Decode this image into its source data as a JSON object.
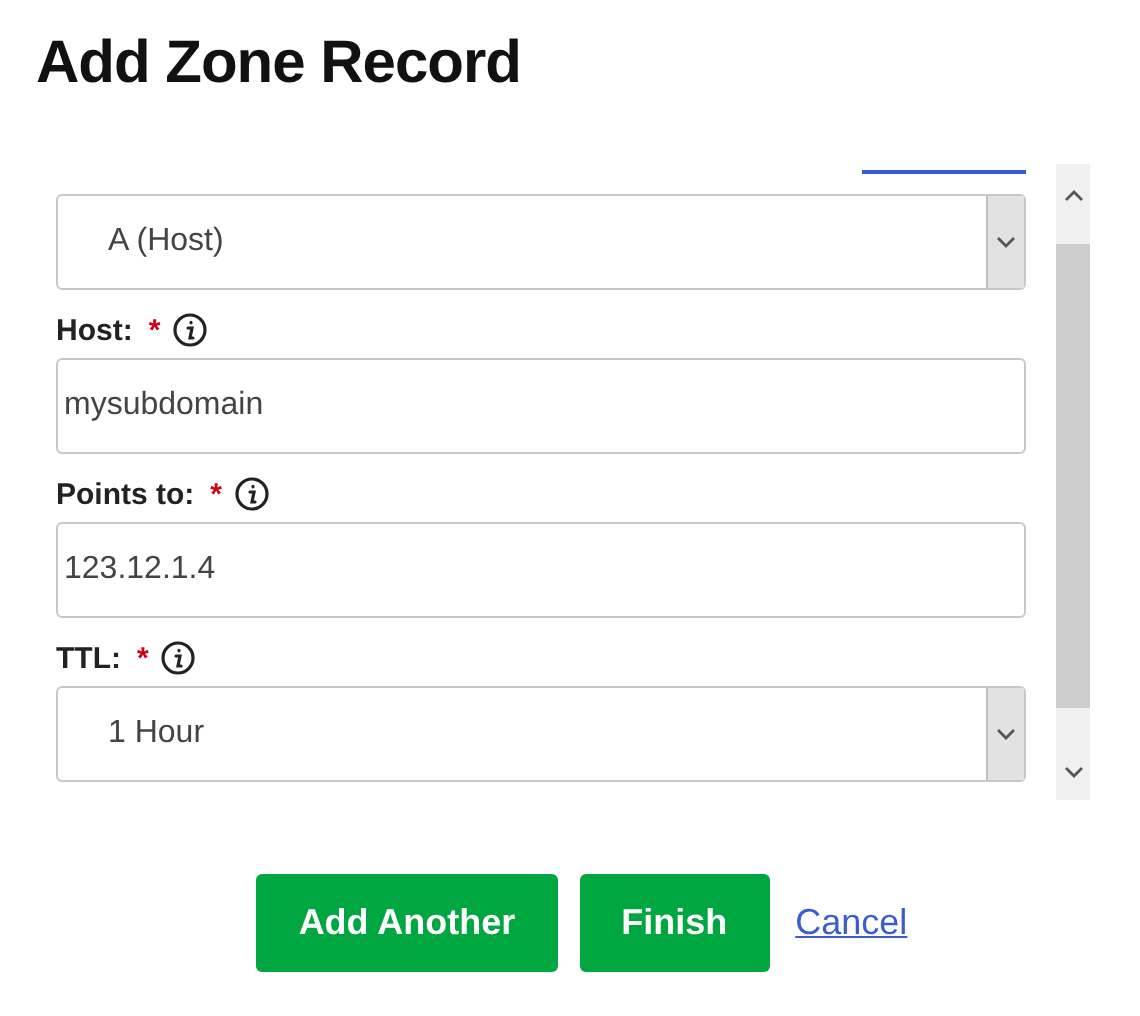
{
  "title": "Add Zone Record",
  "fields": [
    {
      "kind": "select",
      "value": "A (Host)"
    },
    {
      "kind": "text",
      "label": "Host:",
      "required_mark": "*",
      "value": "mysubdomain"
    },
    {
      "kind": "text",
      "label": "Points to:",
      "required_mark": "*",
      "value": "123.12.1.4"
    },
    {
      "kind": "select",
      "label": "TTL:",
      "required_mark": "*",
      "value": "1 Hour"
    }
  ],
  "buttons": [
    "Add Another",
    "Finish"
  ],
  "cancel": "Cancel"
}
